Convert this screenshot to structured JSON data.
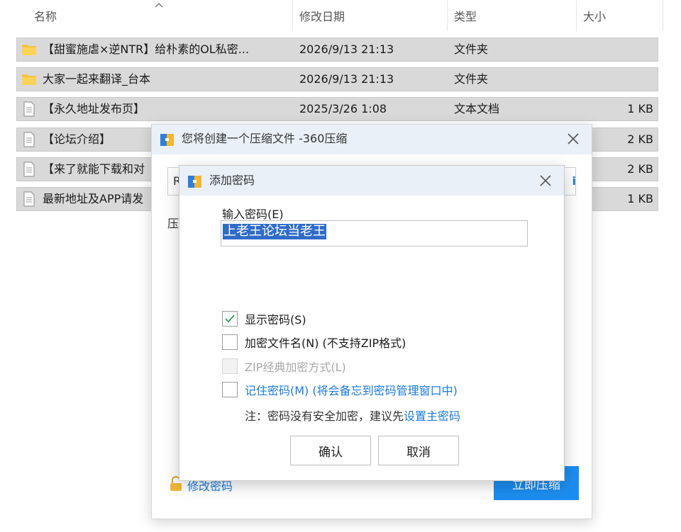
{
  "explorer": {
    "columns": {
      "name": "名称",
      "date": "修改日期",
      "type": "类型",
      "size": "大小"
    },
    "rows": [
      {
        "icon": "folder-icon",
        "name": "【甜蜜施虐×逆NTR】给朴素的OL私密...",
        "date": "2026/9/13 21:13",
        "type": "文件夹",
        "size": ""
      },
      {
        "icon": "folder-icon",
        "name": "大家一起来翻译_台本",
        "date": "2026/9/13 21:13",
        "type": "文件夹",
        "size": ""
      },
      {
        "icon": "document-icon",
        "name": "【永久地址发布页】",
        "date": "2025/3/26 1:08",
        "type": "文本文档",
        "size": "1 KB"
      },
      {
        "icon": "document-icon",
        "name": "【论坛介绍】",
        "date": "",
        "type": "",
        "size": "2 KB"
      },
      {
        "icon": "document-icon",
        "name": "【来了就能下载和对",
        "date": "",
        "type": "",
        "size": "2 KB"
      },
      {
        "icon": "document-icon",
        "name": "最新地址及APP请发",
        "date": "",
        "type": "",
        "size": "1 KB"
      }
    ]
  },
  "compress_dialog": {
    "title": "您将创建一个压缩文件 -360压缩",
    "stub_input_fragment": "R",
    "stub_label_fragment": "压",
    "stub_right_fragment": "i",
    "modify_password": "修改密码",
    "compress_now": "立即压缩"
  },
  "password_dialog": {
    "title": "添加密码",
    "input_label": "输入密码(E)",
    "password_value": "上老王论坛当老王",
    "options": {
      "show_password": {
        "label": "显示密码(S)",
        "checked": true
      },
      "encrypt_filenames": {
        "label": "加密文件名(N) (不支持ZIP格式)",
        "checked": false
      },
      "zip_classic": {
        "label": "ZIP经典加密方式(L)",
        "checked": false,
        "disabled": true
      },
      "remember_password": {
        "label": "记住密码(M) (将会备忘到密码管理窗口中)",
        "checked": false
      }
    },
    "note_text": "注：密码没有安全加密，建议先",
    "note_link": "设置主密码",
    "ok_label": "确认",
    "cancel_label": "取消"
  },
  "colors": {
    "link_blue": "#1a7be0",
    "primary_button": "#1c8ef0",
    "selection": "#2f6cc7",
    "row_gray": "#d9d9d9",
    "titlebar": "#e9f0f8"
  }
}
